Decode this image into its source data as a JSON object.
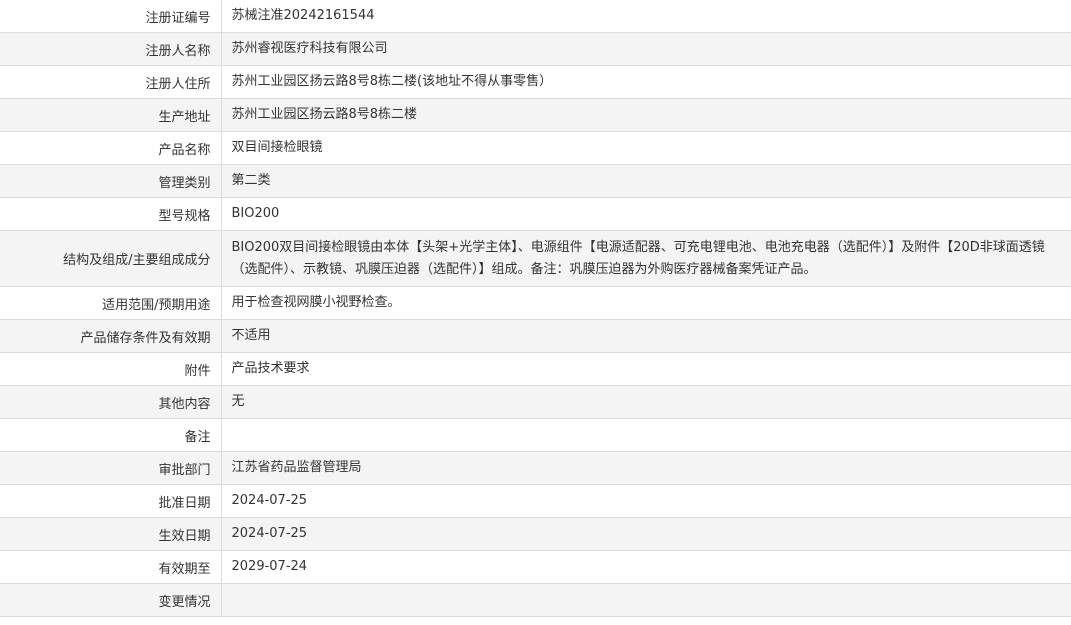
{
  "record": {
    "rows": [
      {
        "label": "注册证编号",
        "value": "苏械注准20242161544"
      },
      {
        "label": "注册人名称",
        "value": "苏州睿视医疗科技有限公司"
      },
      {
        "label": "注册人住所",
        "value": "苏州工业园区扬云路8号8栋二楼(该地址不得从事零售）"
      },
      {
        "label": "生产地址",
        "value": "苏州工业园区扬云路8号8栋二楼"
      },
      {
        "label": "产品名称",
        "value": "双目间接检眼镜"
      },
      {
        "label": "管理类别",
        "value": "第二类"
      },
      {
        "label": "型号规格",
        "value": "BIO200"
      },
      {
        "label": "结构及组成/主要组成成分",
        "value": "BIO200双目间接检眼镜由本体【头架+光学主体】、电源组件【电源适配器、可充电锂电池、电池充电器（选配件）】及附件【20D非球面透镜（选配件）、示教镜、巩膜压迫器（选配件）】组成。备注：巩膜压迫器为外购医疗器械备案凭证产品。"
      },
      {
        "label": "适用范围/预期用途",
        "value": "用于检查视网膜小视野检查。"
      },
      {
        "label": "产品储存条件及有效期",
        "value": "不适用"
      },
      {
        "label": "附件",
        "value": "产品技术要求"
      },
      {
        "label": "其他内容",
        "value": "无"
      },
      {
        "label": "备注",
        "value": ""
      },
      {
        "label": "审批部门",
        "value": "江苏省药品监督管理局"
      },
      {
        "label": "批准日期",
        "value": "2024-07-25"
      },
      {
        "label": "生效日期",
        "value": "2024-07-25"
      },
      {
        "label": "有效期至",
        "value": "2029-07-24"
      },
      {
        "label": "变更情况",
        "value": ""
      }
    ]
  }
}
